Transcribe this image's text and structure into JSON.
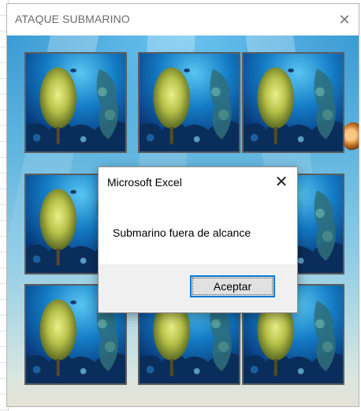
{
  "userform": {
    "title": "ATAQUE SUBMARINO",
    "close_glyph": "✕"
  },
  "board": {
    "cards": [
      {
        "id": 1,
        "image": "coral-reef"
      },
      {
        "id": 2,
        "image": "coral-reef"
      },
      {
        "id": 3,
        "image": "coral-reef"
      },
      {
        "id": 4,
        "image": "coral-reef"
      },
      {
        "id": 5,
        "image": "coral-reef"
      },
      {
        "id": 6,
        "image": "coral-reef"
      },
      {
        "id": 7,
        "image": "coral-reef"
      },
      {
        "id": 8,
        "image": "coral-reef"
      },
      {
        "id": 9,
        "image": "coral-reef"
      }
    ]
  },
  "message_box": {
    "title": "Microsoft Excel",
    "close_glyph": "✕",
    "message": "Submarino fuera de alcance",
    "ok_label": "Aceptar"
  },
  "colors": {
    "accent": "#0078d7",
    "water_top": "#3b9bd4",
    "sand": "#e6e2d5",
    "card_border": "#5e5e5e"
  }
}
